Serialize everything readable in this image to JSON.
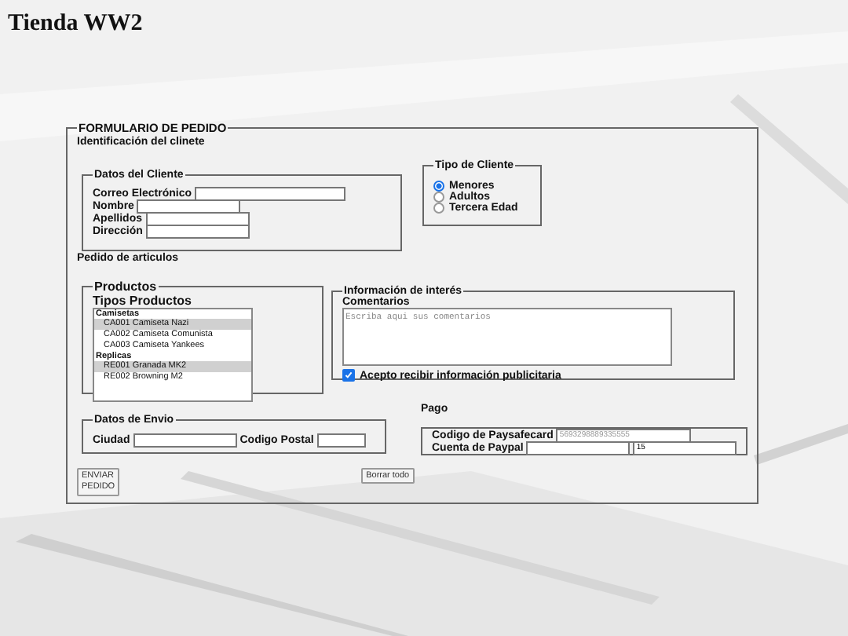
{
  "title": "Tienda WW2",
  "form": {
    "legend": "FORMULARIO DE PEDIDO",
    "identification_heading": "Identificación del clinete",
    "client": {
      "legend": "Datos del Cliente",
      "fields": [
        {
          "label": "Correo Electrónico"
        },
        {
          "label": "Nombre"
        },
        {
          "label": "Apellidos"
        },
        {
          "label": "Dirección"
        }
      ]
    },
    "client_type": {
      "legend": "Tipo de Cliente",
      "options": [
        {
          "label": "Menores",
          "selected": true
        },
        {
          "label": "Adultos",
          "selected": false
        },
        {
          "label": "Tercera Edad",
          "selected": false
        }
      ]
    },
    "order_heading": "Pedido de articulos",
    "products": {
      "legend": "Productos",
      "label": "Tipos Productos",
      "groups": [
        {
          "label": "Camisetas",
          "items": [
            {
              "label": "CA001 Camiseta Nazi",
              "selected": true
            },
            {
              "label": "CA002 Camiseta Comunista",
              "selected": false
            },
            {
              "label": "CA003 Camiseta Yankees",
              "selected": false
            }
          ]
        },
        {
          "label": "Replicas",
          "items": [
            {
              "label": "RE001 Granada MK2",
              "selected": true
            },
            {
              "label": "RE002 Browning M2",
              "selected": false
            }
          ]
        }
      ]
    },
    "info": {
      "legend": "Información de interés",
      "comments_label": "Comentarios",
      "comments_placeholder": "Escriba aqui sus comentarios",
      "accept": {
        "label": "Acepto recibir información publicitaria",
        "checked": true
      }
    },
    "shipping": {
      "legend": "Datos de Envio",
      "city_label": "Ciudad",
      "postal_label": "Codigo Postal"
    },
    "payment": {
      "heading": "Pago",
      "paysafecard_label": "Codigo de Paysafecard",
      "paysafecard_placeholder": "5693298889335555",
      "paypal_label": "Cuenta de Paypal",
      "paypal_value": "15"
    },
    "buttons": {
      "submit": "ENVIAR\nPEDIDO",
      "reset": "Borrar todo"
    }
  }
}
